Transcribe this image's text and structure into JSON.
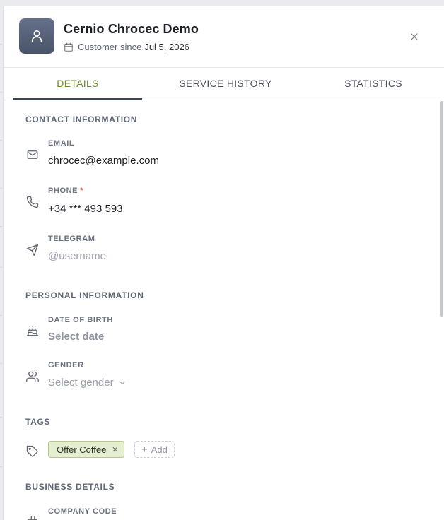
{
  "header": {
    "name": "Cernio Chrocec Demo",
    "since_prefix": "Customer since",
    "since_date": "Jul 5, 2026"
  },
  "tabs": [
    {
      "label": "DETAILS",
      "active": true
    },
    {
      "label": "SERVICE HISTORY",
      "active": false
    },
    {
      "label": "STATISTICS",
      "active": false
    }
  ],
  "contact": {
    "title": "CONTACT INFORMATION",
    "email_label": "EMAIL",
    "email_value": "chrocec@example.com",
    "phone_label": "PHONE",
    "phone_required": "*",
    "phone_value": "+34 *** 493 593",
    "telegram_label": "TELEGRAM",
    "telegram_placeholder": "@username"
  },
  "personal": {
    "title": "PERSONAL INFORMATION",
    "dob_label": "DATE OF BIRTH",
    "dob_placeholder": "Select date",
    "gender_label": "GENDER",
    "gender_placeholder": "Select gender"
  },
  "tags": {
    "title": "TAGS",
    "items": [
      "Offer Coffee"
    ],
    "add_label": "Add"
  },
  "business": {
    "title": "BUSINESS DETAILS",
    "company_code_label": "COMPANY CODE"
  },
  "colors": {
    "accent": "#6b8a2a",
    "avatar": "#566077",
    "tag_bg": "#e6eed2",
    "required": "#e0433a"
  }
}
